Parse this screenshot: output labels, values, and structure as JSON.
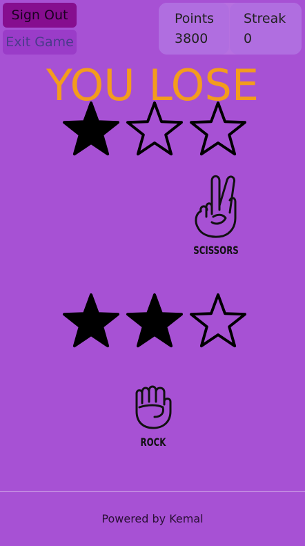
{
  "buttons": {
    "sign_out": "Sign Out",
    "exit_game": "Exit Game"
  },
  "scores": {
    "points_label": "Points",
    "points_value": "3800",
    "streak_label": "Streak",
    "streak_value": "0"
  },
  "result_text": "YOU LOSE",
  "opponent": {
    "stars_filled": 1,
    "stars_total": 3,
    "move_icon": "scissors-hand-icon",
    "move_label": "SCISSORS"
  },
  "player": {
    "stars_filled": 2,
    "stars_total": 3,
    "move_icon": "rock-fist-icon",
    "move_label": "ROCK"
  },
  "footer": "Powered by Kemal",
  "colors": {
    "background": "#a751d4",
    "result": "#f39c1d",
    "sign_out": "#860e8f",
    "exit_game": "#9a3cc8"
  }
}
